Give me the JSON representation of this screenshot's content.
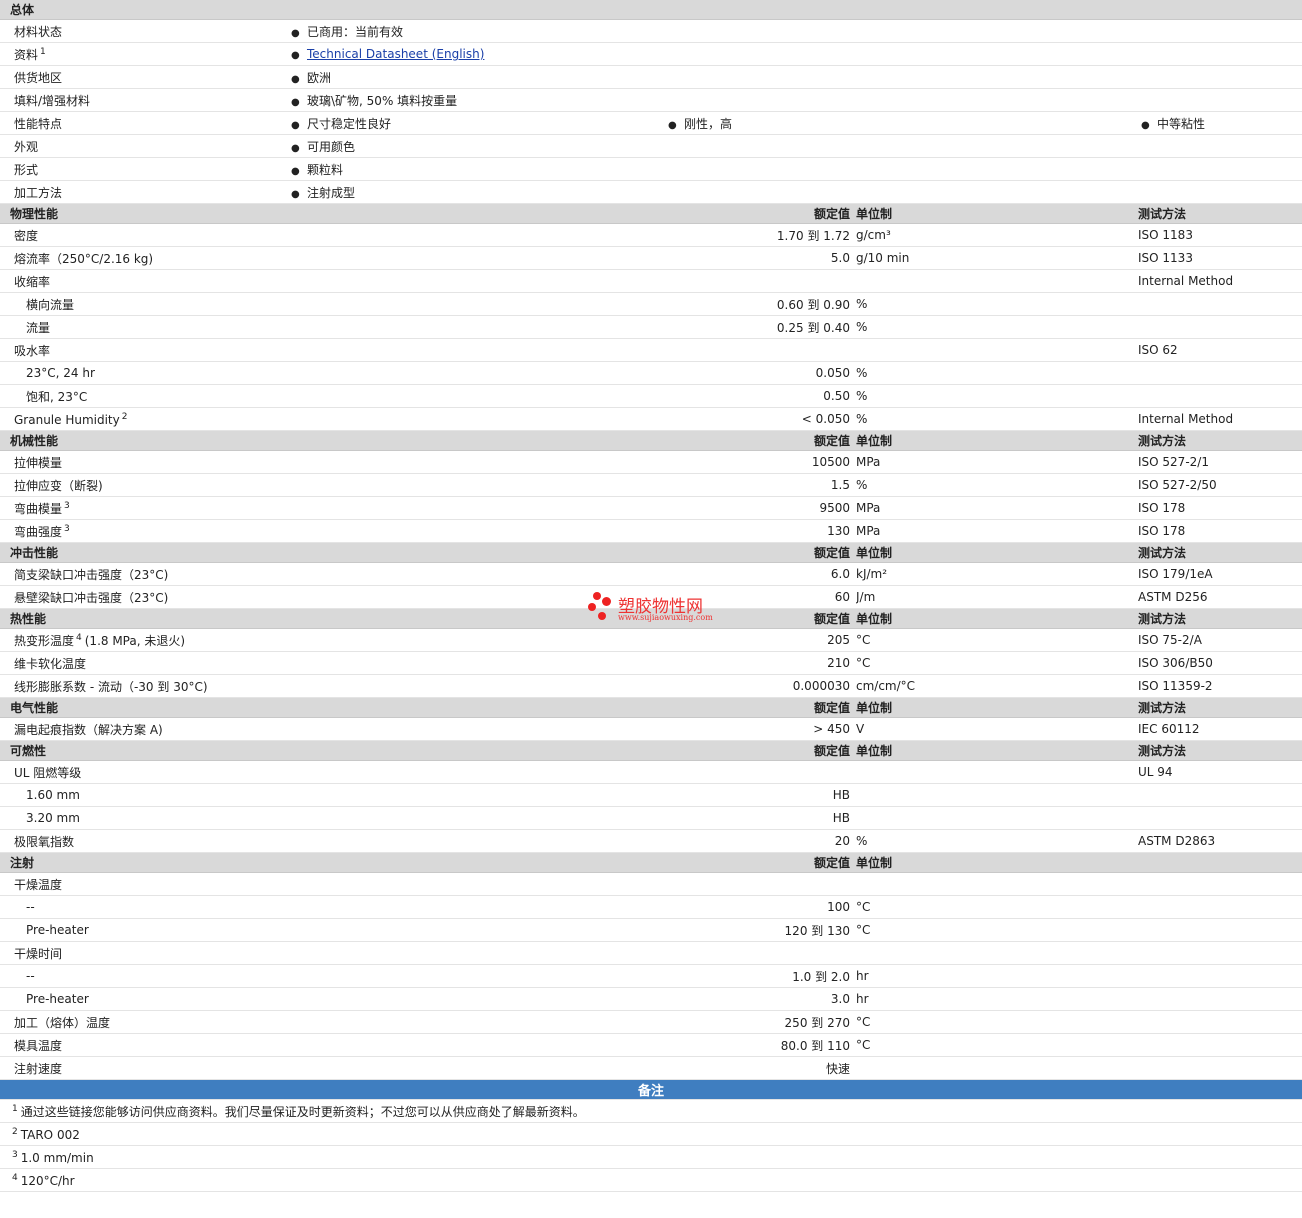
{
  "general": {
    "title": "总体",
    "rows": [
      {
        "label": "材料状态",
        "items": [
          "已商用：当前有效"
        ]
      },
      {
        "label": "资料",
        "ref": "1",
        "link": "Technical Datasheet (English)"
      },
      {
        "label": "供货地区",
        "items": [
          "欧洲"
        ]
      },
      {
        "label": "填料/增强材料",
        "items": [
          "玻璃\\矿物, 50% 填料按重量"
        ]
      },
      {
        "label": "性能特点",
        "items": [
          "尺寸稳定性良好",
          "刚性，高",
          "中等粘性"
        ]
      },
      {
        "label": "外观",
        "items": [
          "可用颜色"
        ]
      },
      {
        "label": "形式",
        "items": [
          "颗粒料"
        ]
      },
      {
        "label": "加工方法",
        "items": [
          "注射成型"
        ]
      }
    ]
  },
  "col_headers": {
    "value": "额定值",
    "unit": "单位制",
    "method": "测试方法"
  },
  "sections": [
    {
      "title": "物理性能",
      "show_method": true,
      "rows": [
        {
          "label": "密度",
          "value": "1.70 到  1.72",
          "unit": "g/cm³",
          "method": "ISO 1183"
        },
        {
          "label": "熔流率（250°C/2.16 kg)",
          "value": "5.0",
          "unit": "g/10 min",
          "method": "ISO 1133"
        },
        {
          "label": "收缩率",
          "value": "",
          "unit": "",
          "method": "Internal Method"
        },
        {
          "label": "横向流量",
          "sub": true,
          "value": "0.60 到  0.90",
          "unit": "%",
          "method": ""
        },
        {
          "label": "流量",
          "sub": true,
          "value": "0.25 到  0.40",
          "unit": "%",
          "method": ""
        },
        {
          "label": "吸水率",
          "value": "",
          "unit": "",
          "method": "ISO 62"
        },
        {
          "label": "23°C, 24 hr",
          "sub": true,
          "value": "0.050",
          "unit": "%",
          "method": ""
        },
        {
          "label": "饱和, 23°C",
          "sub": true,
          "value": "0.50",
          "unit": "%",
          "method": ""
        },
        {
          "label": "Granule Humidity",
          "ref": "2",
          "value": "< 0.050",
          "unit": "%",
          "method": "Internal Method"
        }
      ]
    },
    {
      "title": "机械性能",
      "show_method": true,
      "rows": [
        {
          "label": "拉伸模量",
          "value": "10500",
          "unit": "MPa",
          "method": "ISO 527-2/1"
        },
        {
          "label": "拉伸应变（断裂)",
          "value": "1.5",
          "unit": "%",
          "method": "ISO 527-2/50"
        },
        {
          "label": "弯曲模量",
          "ref": "3",
          "value": "9500",
          "unit": "MPa",
          "method": "ISO 178"
        },
        {
          "label": "弯曲强度",
          "ref": "3",
          "value": "130",
          "unit": "MPa",
          "method": "ISO 178"
        }
      ]
    },
    {
      "title": "冲击性能",
      "show_method": true,
      "rows": [
        {
          "label": "简支梁缺口冲击强度（23°C)",
          "value": "6.0",
          "unit": "kJ/m²",
          "method": "ISO 179/1eA"
        },
        {
          "label": "悬壁梁缺口冲击强度（23°C)",
          "value": "60",
          "unit": "J/m",
          "method": "ASTM D256"
        }
      ]
    },
    {
      "title": "热性能",
      "show_method": true,
      "rows": [
        {
          "label": "热变形温度",
          "ref": "4",
          "suffix": "(1.8 MPa, 未退火)",
          "value": "205",
          "unit": "°C",
          "method": "ISO 75-2/A"
        },
        {
          "label": "维卡软化温度",
          "value": "210",
          "unit": "°C",
          "method": "ISO 306/B50"
        },
        {
          "label": "线形膨胀系数 - 流动（-30 到  30°C)",
          "value": "0.000030",
          "unit": "cm/cm/°C",
          "method": "ISO 11359-2"
        }
      ]
    },
    {
      "title": "电气性能",
      "show_method": true,
      "rows": [
        {
          "label": "漏电起痕指数（解决方案  A)",
          "value": "> 450",
          "unit": "V",
          "method": "IEC 60112"
        }
      ]
    },
    {
      "title": "可燃性",
      "show_method": true,
      "rows": [
        {
          "label": "UL 阻燃等级",
          "value": "",
          "unit": "",
          "method": "UL 94"
        },
        {
          "label": "1.60 mm",
          "sub": true,
          "value": "HB",
          "unit": "",
          "method": ""
        },
        {
          "label": "3.20 mm",
          "sub": true,
          "value": "HB",
          "unit": "",
          "method": ""
        },
        {
          "label": "极限氧指数",
          "value": "20",
          "unit": "%",
          "method": "ASTM D2863"
        }
      ]
    },
    {
      "title": "注射",
      "show_method": false,
      "rows": [
        {
          "label": "干燥温度",
          "value": "",
          "unit": "",
          "method": ""
        },
        {
          "label": "--",
          "sub": true,
          "value": "100",
          "unit": "°C",
          "method": ""
        },
        {
          "label": "Pre-heater",
          "sub": true,
          "value": "120 到  130",
          "unit": "°C",
          "method": ""
        },
        {
          "label": "干燥时间",
          "value": "",
          "unit": "",
          "method": ""
        },
        {
          "label": "--",
          "sub": true,
          "value": "1.0 到  2.0",
          "unit": "hr",
          "method": ""
        },
        {
          "label": "Pre-heater",
          "sub": true,
          "value": "3.0",
          "unit": "hr",
          "method": ""
        },
        {
          "label": "加工（熔体）温度",
          "value": "250 到  270",
          "unit": "°C",
          "method": ""
        },
        {
          "label": "模具温度",
          "value": "80.0 到  110",
          "unit": "°C",
          "method": ""
        },
        {
          "label": "注射速度",
          "value": "快速",
          "unit": "",
          "method": ""
        }
      ]
    }
  ],
  "notes": {
    "title": "备注",
    "items": [
      {
        "ref": "1",
        "text": "通过这些链接您能够访问供应商资料。我们尽量保证及时更新资料；不过您可以从供应商处了解最新资料。"
      },
      {
        "ref": "2",
        "text": "TARO 002"
      },
      {
        "ref": "3",
        "text": "1.0 mm/min"
      },
      {
        "ref": "4",
        "text": "120°C/hr"
      }
    ]
  },
  "watermark": {
    "name": "塑胶物性网",
    "url": "www.sujiaowuxing.com"
  }
}
